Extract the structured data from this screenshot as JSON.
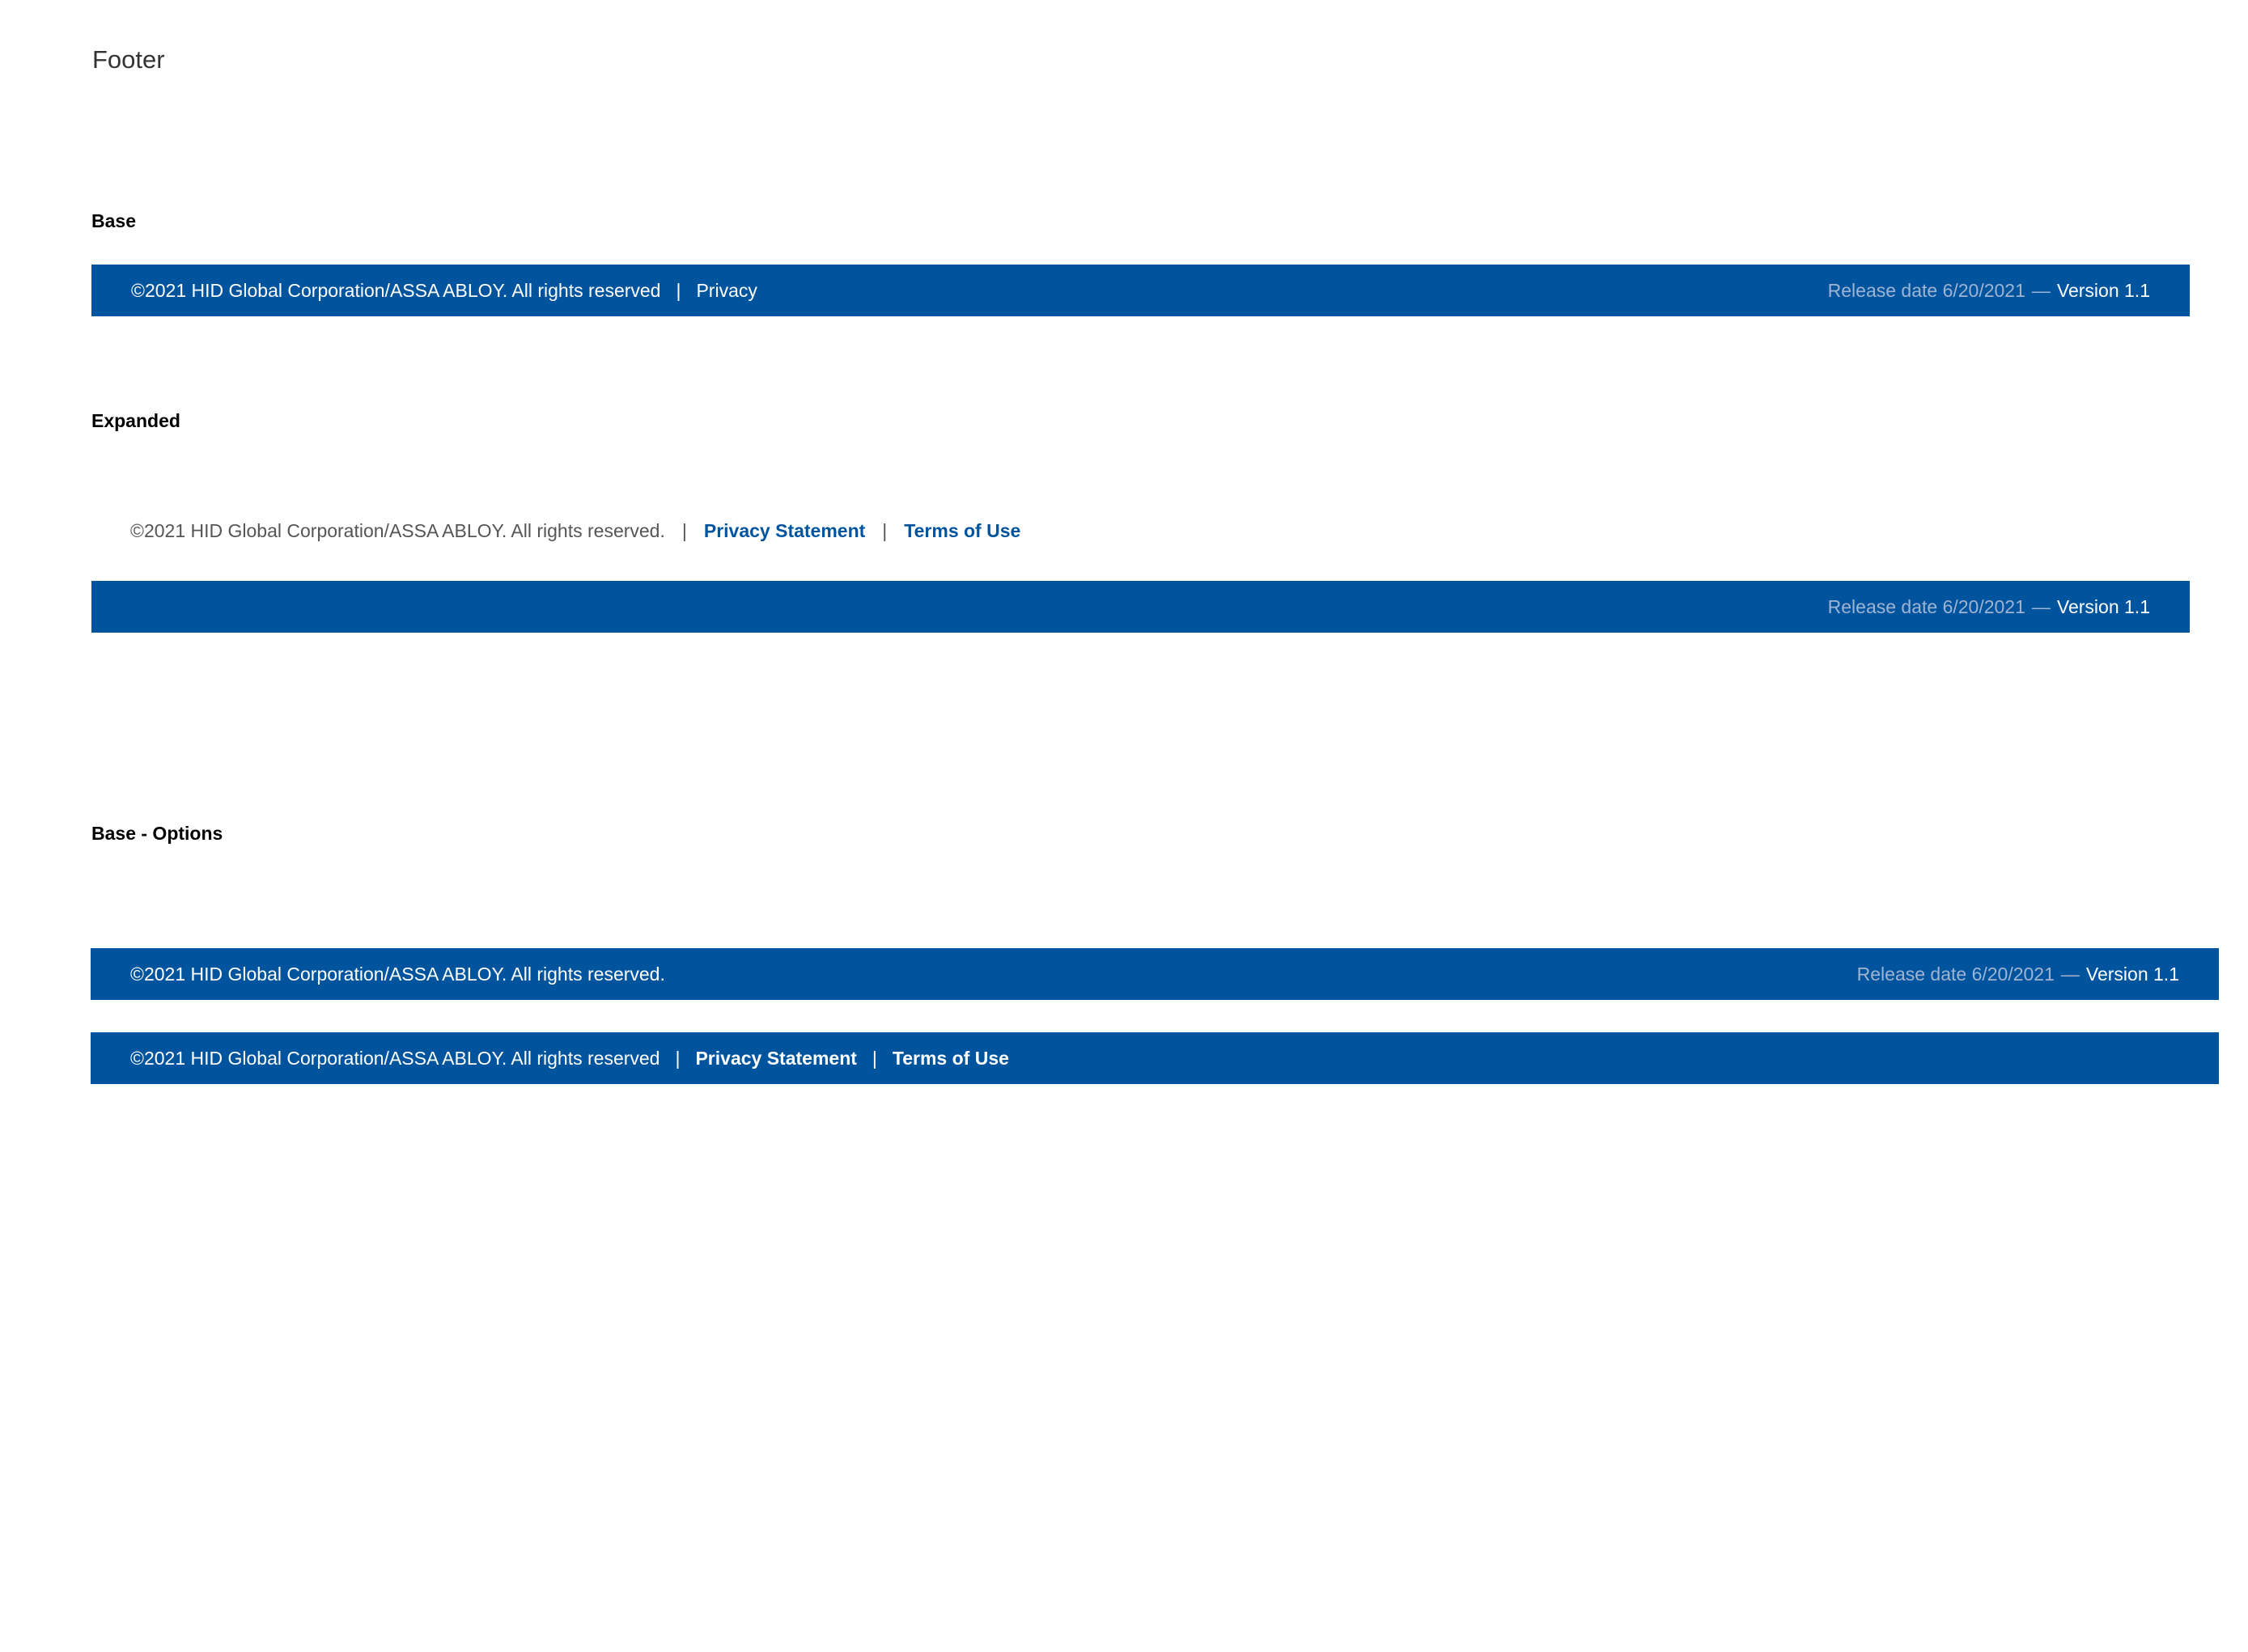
{
  "page": {
    "title": "Footer"
  },
  "sections": {
    "base": {
      "label": "Base"
    },
    "expanded": {
      "label": "Expanded"
    },
    "base_options": {
      "label": "Base - Options"
    }
  },
  "footer_base": {
    "copyright": "©2021 HID Global Corporation/ASSA ABLOY. All rights reserved",
    "separator": "|",
    "privacy_link": "Privacy",
    "release": "Release date 6/20/2021",
    "dash": "—",
    "version": "Version 1.1"
  },
  "footer_expanded": {
    "copyright": "©2021 HID Global Corporation/ASSA ABLOY. All rights reserved.",
    "separator": "|",
    "privacy_link": "Privacy Statement",
    "terms_link": "Terms of Use",
    "release": "Release date 6/20/2021",
    "dash": "—",
    "version": "Version 1.1"
  },
  "footer_option_1": {
    "copyright": "©2021 HID Global Corporation/ASSA ABLOY. All rights reserved.",
    "release": "Release date 6/20/2021",
    "dash": "—",
    "version": "Version 1.1"
  },
  "footer_option_2": {
    "copyright": "©2021 HID Global Corporation/ASSA ABLOY. All rights reserved",
    "separator": "|",
    "privacy_link": "Privacy Statement",
    "terms_link": "Terms of Use"
  },
  "colors": {
    "brand_blue": "#00549e",
    "release_text": "#9fb4d2",
    "white": "#ffffff",
    "body_text": "#555555"
  }
}
